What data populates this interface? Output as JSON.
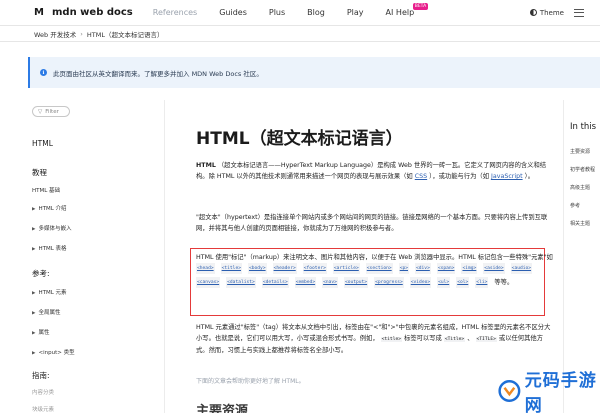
{
  "nav": {
    "logo_mark": "M",
    "logo_text": "mdn web docs",
    "items": [
      "References",
      "Guides",
      "Plus",
      "Blog",
      "Play",
      "AI Help"
    ],
    "ai_badge": "BETA",
    "theme_label": "Theme"
  },
  "breadcrumb": [
    "Web 开发技术",
    "HTML（超文本标记语言）"
  ],
  "notice": {
    "text": "此页面由社区从英文翻译而来。了解更多并加入 MDN Web Docs 社区。"
  },
  "sidebar": {
    "filter_placeholder": "Filter",
    "title": "HTML",
    "sections": [
      {
        "heading": "教程",
        "items": [
          "HTML 基础",
          "HTML 介绍",
          "多媒体与嵌入",
          "HTML 表格"
        ]
      },
      {
        "heading": "参考:",
        "items": [
          "HTML 元素",
          "全局属性",
          "属性",
          "<input> 类型"
        ]
      },
      {
        "heading": "指南:",
        "items": [
          "内容分类",
          "块级元素"
        ]
      }
    ]
  },
  "article": {
    "title": "HTML（超文本标记语言）",
    "p1_strong": "HTML",
    "p1_a": "（超文本标记语言——HyperText Markup Language）是构成 Web 世界的一砖一瓦。它定义了网页内容的含义和结构。除 HTML 以外的其他技术则通常用来描述一个网页的表现与展示效果（如",
    "p1_css": "CSS",
    "p1_b": "），或功能与行为（如",
    "p1_js": "JavaScript",
    "p1_c": "）。",
    "p2": "\"超文本\"（hypertext）是指连接单个网站内或多个网站间的网页的链接。链接是网络的一个基本方面。只要将内容上传到互联网，并将其与他人创建的页面相链接，你就成为了万维网的积极参与者。",
    "p3_a": "HTML 使用\"标记\"（markup）来注明文本、图片和其他内容，以便于在 Web 浏览器中显示。HTML 标记包含一些特殊\"元素\"如",
    "p3_tags": [
      "<head>",
      "<title>",
      "<body>",
      "<header>",
      "<footer>",
      "<article>",
      "<section>",
      "<p>",
      "<div>",
      "<span>",
      "<img>",
      "<aside>",
      "<audio>",
      "<canvas>",
      "<datalist>",
      "<details>",
      "<embed>",
      "<nav>",
      "<output>",
      "<progress>",
      "<video>",
      "<ul>",
      "<ol>",
      "<li>"
    ],
    "p3_b": "等等。",
    "p4_a": "HTML 元素通过\"标签\"（tag）将文本从文档中引出，标签由在\"<\"和\">\"中包裹的元素名组成，HTML 标签里的元素名不区分大小写。也就是说，它们可以用大写，小写或混合形式书写。例如，",
    "p4_tag1": "<title>",
    "p4_b": "标签可以写成",
    "p4_tag2": "<Title>",
    "p4_c": "、",
    "p4_tag3": "<TITLE>",
    "p4_d": "或以任何其他方式。然而，习惯上与实践上都推荐将标签名全部小写。",
    "note": "下面的文章会帮助你更好地了解 HTML。",
    "subheading": "主要资源"
  },
  "toc": {
    "title": "In this",
    "items": [
      "主要资源",
      "初学者教程",
      "高级主题",
      "参考",
      "相关主题"
    ]
  },
  "watermark": {
    "text": "元码手游网"
  },
  "colors": {
    "link": "#2c5fb0",
    "highlight_border": "#e43a3a",
    "notice_bg": "#ecf3fb",
    "watermark": "#1f6fd6"
  }
}
